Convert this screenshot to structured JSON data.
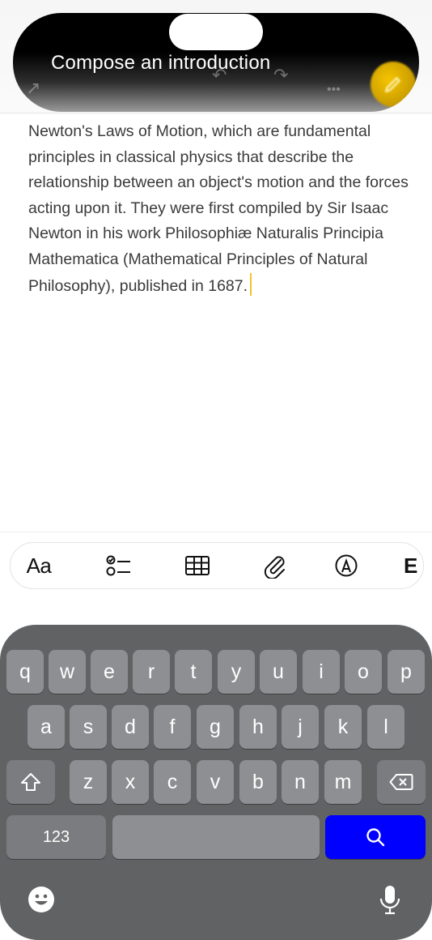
{
  "banner": {
    "title": "Compose an introduction"
  },
  "note": {
    "text": "Newton's Laws of Motion, which are fundamental principles in classical physics that describe the relationship between an object's motion and the forces acting upon it. They were first compiled by Sir Isaac Newton in his work Philosophiæ Naturalis Principia Mathematica (Mathematical Principles of Natural Philosophy), published in 1687."
  },
  "format_toolbar": {
    "text_style_label": "Aa",
    "more_label": "E"
  },
  "keyboard": {
    "row1": [
      "q",
      "w",
      "e",
      "r",
      "t",
      "y",
      "u",
      "i",
      "o",
      "p"
    ],
    "row2": [
      "a",
      "s",
      "d",
      "f",
      "g",
      "h",
      "j",
      "k",
      "l"
    ],
    "row3": [
      "z",
      "x",
      "c",
      "v",
      "b",
      "n",
      "m"
    ],
    "numbers_label": "123",
    "search_key_color": "#0000ff"
  },
  "colors": {
    "keyboard_bg": "#616264",
    "key_bg": "#8e8f92",
    "caret": "#f2c230",
    "compose_accent": "#f5c400"
  }
}
